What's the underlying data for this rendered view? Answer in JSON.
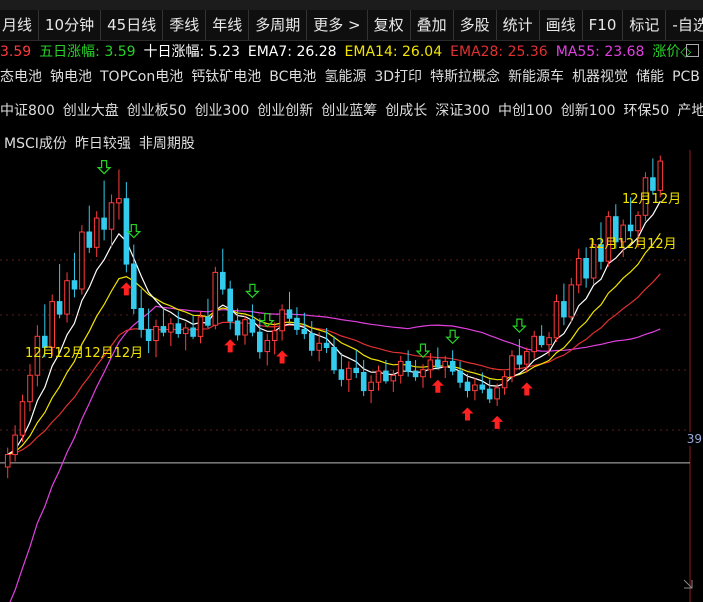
{
  "top_strip_text": "",
  "toolbar": {
    "items": [
      "月线",
      "10分钟",
      "45日线",
      "季线",
      "年线",
      "多周期",
      "更多 >",
      "复权",
      "叠加",
      "多股",
      "统计",
      "画线",
      "F10",
      "标记",
      "-自选"
    ]
  },
  "indicators": [
    {
      "label": "3.59",
      "value": "",
      "color": "#ff3b3b"
    },
    {
      "label": "五日涨幅:",
      "value": "3.59",
      "color": "#27d227"
    },
    {
      "label": "十日涨幅:",
      "value": "5.23",
      "color": "#ffffff"
    },
    {
      "label": "EMA7:",
      "value": "26.28",
      "color": "#ffffff"
    },
    {
      "label": "EMA14:",
      "value": "26.04",
      "color": "#f2e400"
    },
    {
      "label": "EMA28:",
      "value": "25.36",
      "color": "#e03030"
    },
    {
      "label": "MA55:",
      "value": "23.68",
      "color": "#e040e0"
    },
    {
      "label": "涨价◇",
      "value": "",
      "color": "#27d227"
    }
  ],
  "concept_rows": [
    [
      "态电池",
      "钠电池",
      "TOPCon电池",
      "钙钛矿电池",
      "BC电池",
      "氢能源",
      "3D打印",
      "特斯拉概念",
      "新能源车",
      "机器视觉",
      "储能",
      "PCB"
    ],
    [
      "中证800",
      "创业大盘",
      "创业板50",
      "创业300",
      "创业创新",
      "创业蓝筹",
      "创成长",
      "深证300",
      "中创100",
      "创新100",
      "环保50",
      "产地信"
    ],
    [
      "MSCI成份",
      "昨日较强",
      "非周期股"
    ]
  ],
  "price_axis_label": "39",
  "annotations": [
    {
      "text": "12月12月12月12月",
      "color": "#f2e400"
    },
    {
      "text": "12月12月",
      "color": "#f2e400"
    },
    {
      "text": "12月12月12月",
      "color": "#f2e400"
    }
  ],
  "colors": {
    "up_candle": "#ff3b3b",
    "down_candle": "#33ccee",
    "ema7": "#ffffff",
    "ema14": "#f2e400",
    "ema28": "#e03030",
    "ma55": "#e040e0",
    "buy_arrow": "#ff2020",
    "sell_arrow": "#27d227"
  },
  "chart_data": {
    "type": "candlestick",
    "title": "",
    "ylim": [
      14,
      46
    ],
    "ohlc": [
      [
        23.2,
        24.6,
        22.4,
        24.1
      ],
      [
        24.1,
        26.2,
        23.6,
        25.5
      ],
      [
        25.5,
        28.4,
        25.0,
        27.9
      ],
      [
        27.9,
        30.6,
        27.2,
        29.8
      ],
      [
        29.8,
        33.4,
        29.0,
        32.6
      ],
      [
        32.6,
        34.9,
        31.1,
        31.8
      ],
      [
        31.8,
        35.6,
        31.2,
        35.1
      ],
      [
        35.1,
        37.8,
        33.9,
        34.2
      ],
      [
        34.2,
        37.2,
        33.6,
        36.6
      ],
      [
        36.6,
        38.6,
        35.4,
        36.0
      ],
      [
        36.0,
        40.6,
        35.6,
        40.1
      ],
      [
        40.1,
        42.0,
        38.6,
        39.0
      ],
      [
        39.0,
        41.6,
        38.3,
        41.1
      ],
      [
        41.1,
        43.8,
        39.5,
        40.3
      ],
      [
        40.3,
        42.8,
        39.0,
        42.2
      ],
      [
        42.2,
        44.6,
        41.0,
        42.5
      ],
      [
        42.5,
        43.7,
        37.2,
        37.8
      ],
      [
        37.8,
        39.2,
        34.2,
        34.6
      ],
      [
        34.6,
        36.0,
        32.5,
        33.1
      ],
      [
        33.1,
        34.6,
        31.4,
        32.3
      ],
      [
        32.3,
        33.8,
        31.1,
        33.3
      ],
      [
        33.3,
        34.6,
        32.6,
        32.9
      ],
      [
        32.9,
        33.9,
        31.9,
        33.5
      ],
      [
        33.5,
        34.4,
        32.5,
        32.8
      ],
      [
        32.8,
        33.6,
        31.6,
        33.2
      ],
      [
        33.2,
        34.1,
        32.4,
        32.6
      ],
      [
        32.6,
        34.4,
        32.1,
        34.0
      ],
      [
        34.0,
        35.3,
        33.2,
        33.4
      ],
      [
        33.4,
        37.6,
        33.1,
        37.2
      ],
      [
        37.2,
        38.9,
        35.6,
        36.0
      ],
      [
        36.0,
        36.6,
        33.1,
        33.7
      ],
      [
        33.7,
        34.6,
        32.3,
        32.7
      ],
      [
        32.7,
        34.1,
        32.0,
        33.8
      ],
      [
        33.8,
        34.9,
        32.6,
        32.9
      ],
      [
        32.9,
        33.9,
        31.0,
        31.5
      ],
      [
        31.5,
        32.8,
        30.5,
        32.3
      ],
      [
        32.3,
        33.6,
        31.3,
        33.0
      ],
      [
        33.0,
        34.9,
        32.3,
        34.5
      ],
      [
        34.5,
        35.8,
        33.6,
        33.9
      ],
      [
        33.9,
        34.7,
        32.7,
        33.1
      ],
      [
        33.1,
        34.3,
        32.4,
        32.8
      ],
      [
        32.8,
        33.7,
        31.2,
        31.6
      ],
      [
        31.6,
        32.9,
        30.8,
        32.1
      ],
      [
        32.1,
        33.2,
        31.4,
        31.8
      ],
      [
        31.8,
        32.6,
        29.9,
        30.2
      ],
      [
        30.2,
        31.4,
        29.0,
        29.5
      ],
      [
        29.5,
        30.8,
        28.6,
        30.3
      ],
      [
        30.3,
        31.6,
        29.6,
        30.0
      ],
      [
        30.0,
        30.9,
        28.3,
        28.7
      ],
      [
        28.7,
        29.8,
        27.8,
        29.3
      ],
      [
        29.3,
        30.5,
        28.7,
        30.1
      ],
      [
        30.1,
        30.9,
        29.2,
        29.4
      ],
      [
        29.4,
        30.2,
        28.6,
        29.8
      ],
      [
        29.8,
        31.2,
        29.2,
        30.8
      ],
      [
        30.8,
        31.6,
        29.7,
        30.1
      ],
      [
        30.1,
        30.9,
        29.4,
        29.7
      ],
      [
        29.7,
        30.6,
        28.9,
        30.2
      ],
      [
        30.2,
        31.4,
        29.6,
        30.9
      ],
      [
        30.9,
        31.8,
        30.2,
        30.4
      ],
      [
        30.4,
        31.2,
        29.6,
        30.8
      ],
      [
        30.8,
        31.6,
        29.8,
        30.1
      ],
      [
        30.1,
        30.8,
        28.9,
        29.3
      ],
      [
        29.3,
        29.9,
        28.2,
        28.7
      ],
      [
        28.7,
        29.6,
        28.0,
        29.1
      ],
      [
        29.1,
        30.0,
        28.5,
        28.8
      ],
      [
        28.8,
        29.5,
        27.8,
        28.1
      ],
      [
        28.1,
        29.2,
        27.6,
        28.9
      ],
      [
        28.9,
        30.1,
        28.4,
        29.7
      ],
      [
        29.7,
        31.6,
        29.3,
        31.2
      ],
      [
        31.2,
        32.4,
        30.2,
        30.6
      ],
      [
        30.6,
        31.8,
        30.0,
        31.5
      ],
      [
        31.5,
        33.0,
        31.0,
        32.6
      ],
      [
        32.6,
        33.4,
        31.8,
        32.0
      ],
      [
        32.0,
        32.9,
        31.2,
        32.5
      ],
      [
        32.5,
        35.6,
        32.2,
        35.1
      ],
      [
        35.1,
        36.4,
        33.4,
        34.0
      ],
      [
        34.0,
        36.8,
        33.6,
        36.3
      ],
      [
        36.3,
        38.9,
        35.7,
        38.2
      ],
      [
        38.2,
        39.0,
        36.1,
        36.8
      ],
      [
        36.8,
        39.6,
        36.3,
        39.2
      ],
      [
        39.2,
        40.8,
        37.4,
        38.0
      ],
      [
        38.0,
        41.6,
        37.6,
        41.2
      ],
      [
        41.2,
        42.1,
        38.9,
        39.4
      ],
      [
        39.4,
        41.0,
        38.3,
        40.6
      ],
      [
        40.6,
        42.6,
        39.7,
        40.2
      ],
      [
        40.2,
        41.6,
        39.0,
        41.3
      ],
      [
        41.3,
        44.4,
        40.9,
        44.0
      ],
      [
        44.0,
        45.4,
        42.8,
        43.1
      ],
      [
        43.1,
        45.6,
        42.6,
        45.2
      ]
    ],
    "series": [
      {
        "name": "EMA7",
        "values": []
      },
      {
        "name": "EMA14",
        "values": []
      },
      {
        "name": "EMA28",
        "values": []
      },
      {
        "name": "MA55",
        "values": []
      }
    ],
    "buy_signals_index": [
      16,
      30,
      37,
      58,
      62,
      66,
      70
    ],
    "sell_signals_index": [
      13,
      17,
      33,
      35,
      56,
      60,
      69
    ],
    "horizontal_line_value": 23.5
  }
}
